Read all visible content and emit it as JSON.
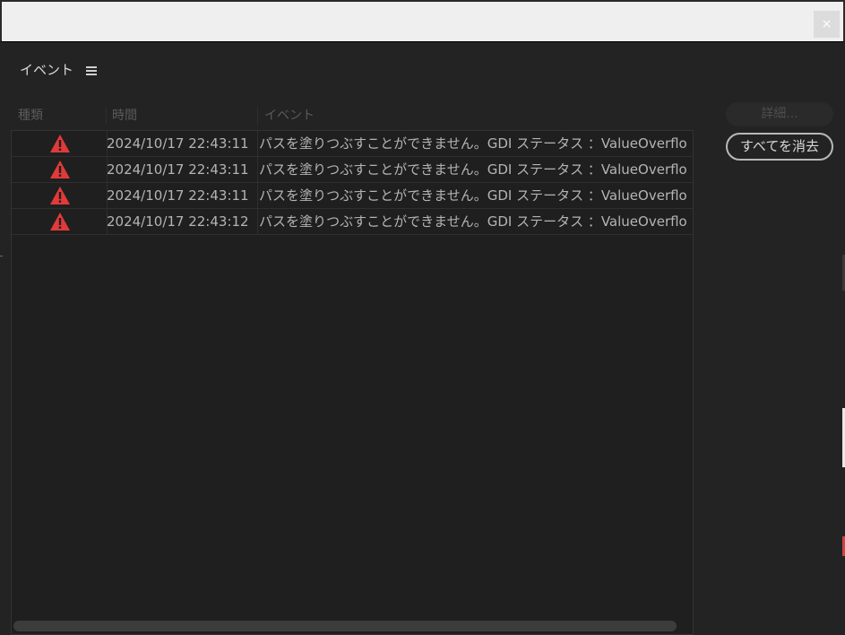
{
  "window": {
    "close_label": "×"
  },
  "panel": {
    "title": "イベント",
    "menu_icon": "hamburger-menu-icon"
  },
  "table": {
    "columns": [
      "種類",
      "時間",
      "イベント"
    ],
    "rows": [
      {
        "type_icon": "warning-icon",
        "time": "2024/10/17 22:43:11",
        "event": "パスを塗りつぶすことができません。GDI ステータス ：ValueOverflo"
      },
      {
        "type_icon": "warning-icon",
        "time": "2024/10/17 22:43:11",
        "event": "パスを塗りつぶすことができません。GDI ステータス ：ValueOverflo"
      },
      {
        "type_icon": "warning-icon",
        "time": "2024/10/17 22:43:11",
        "event": "パスを塗りつぶすことができません。GDI ステータス ：ValueOverflo"
      },
      {
        "type_icon": "warning-icon",
        "time": "2024/10/17 22:43:12",
        "event": "パスを塗りつぶすことができません。GDI ステータス ：ValueOverflo"
      }
    ]
  },
  "buttons": {
    "details_label": "詳細...",
    "clear_all_label": "すべてを消去"
  },
  "colors": {
    "warning": "#e03a3a",
    "background": "#232323",
    "titlebar": "#efefef"
  }
}
